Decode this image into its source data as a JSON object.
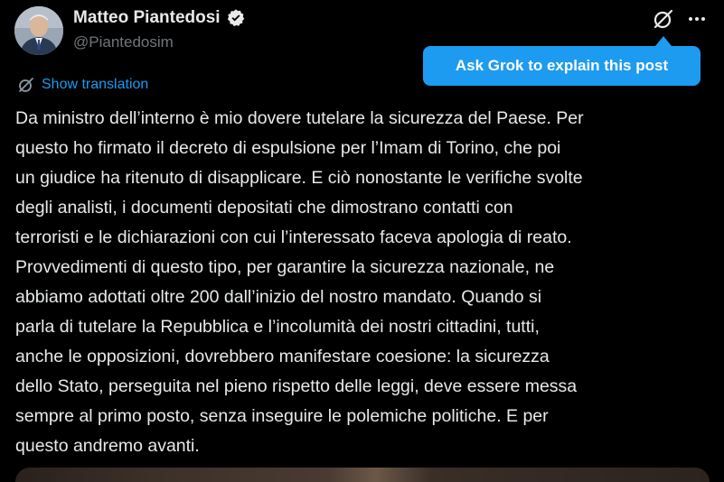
{
  "author": {
    "name": "Matteo Piantedosi",
    "handle": "@Piantedosim",
    "verified": true,
    "avatar_icon": "profile-photo"
  },
  "header_actions": {
    "grok_icon": "grok-icon",
    "more_icon": "ellipsis-icon"
  },
  "tooltip": {
    "label": "Ask Grok to explain this post"
  },
  "translation": {
    "label": "Show translation",
    "icon": "grok-icon"
  },
  "post": {
    "lines": [
      "Da ministro dell’interno è mio dovere tutelare la sicurezza del Paese. Per",
      "questo ho firmato il decreto di espulsione per l’Imam di Torino, che poi",
      "un giudice ha ritenuto di disapplicare. E ciò nonostante le verifiche svolte",
      "degli analisti, i documenti depositati che dimostrano contatti con",
      "terroristi e le dichiarazioni con cui l’interessato faceva apologia di reato.",
      "Provvedimenti di questo tipo, per garantire la sicurezza nazionale, ne",
      "abbiamo adottati oltre 200 dall’inizio del nostro mandato. Quando si",
      "parla di tutelare la Repubblica e l’incolumità dei nostri cittadini, tutti,",
      "anche le opposizioni, dovrebbero manifestare coesione: la sicurezza",
      "dello Stato, perseguita nel pieno rispetto delle leggi, deve essere messa",
      "sempre al primo posto, senza inseguire le polemiche politiche. E per",
      "questo andremo avanti."
    ]
  },
  "colors": {
    "background": "#000000",
    "text": "#e7e9ea",
    "secondary_text": "#71767b",
    "accent": "#1d9bf0"
  }
}
